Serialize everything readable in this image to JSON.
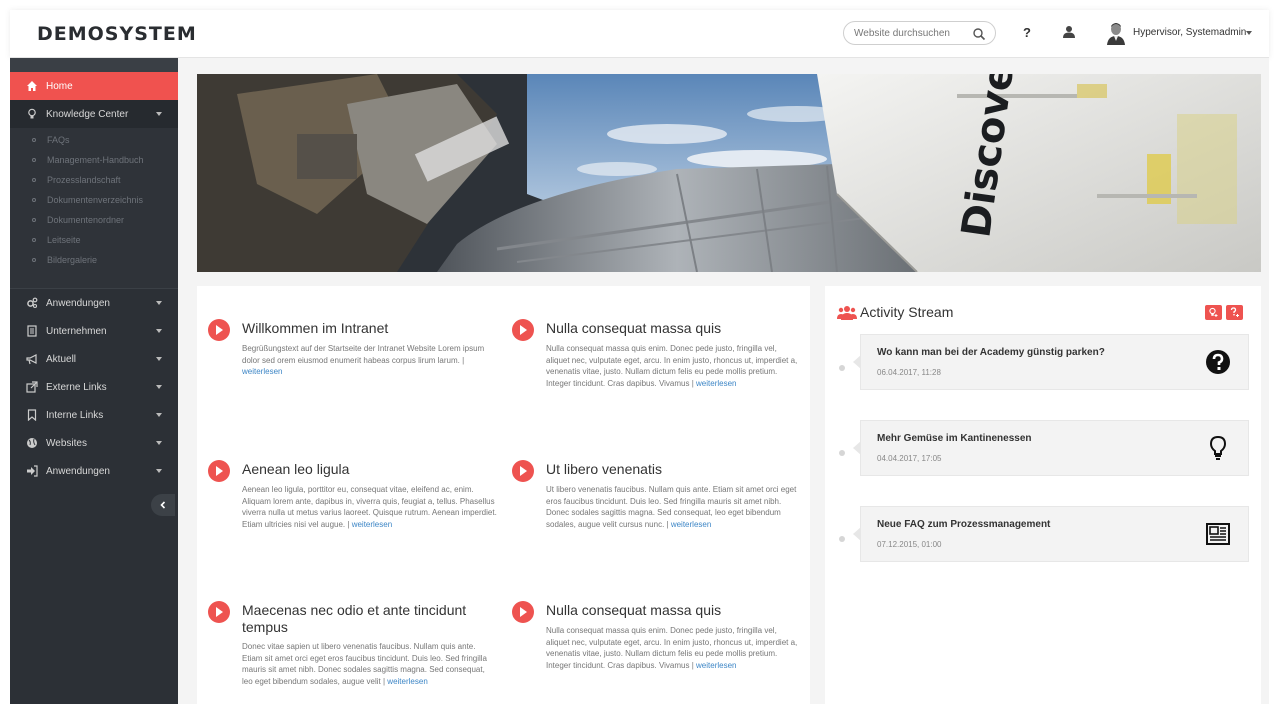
{
  "header": {
    "logo": "DEMOSYSTEM",
    "search_placeholder": "Website durchsuchen",
    "help_label": "?",
    "user_name": "Hypervisor, Systemadmin"
  },
  "sidebar": {
    "home_label": "Home",
    "knowledge_center": {
      "label": "Knowledge Center",
      "subitems": [
        "FAQs",
        "Management-Handbuch",
        "Prozesslandschaft",
        "Dokumentenverzeichnis",
        "Dokumentenordner",
        "Leitseite",
        "Bildergalerie"
      ]
    },
    "items": [
      "Anwendungen",
      "Unternehmen",
      "Aktuell",
      "Externe Links",
      "Interne Links",
      "Websites",
      "Anwendungen"
    ]
  },
  "articles": [
    {
      "title": "Willkommen im Intranet",
      "text": "Begrüßungstext auf der Startseite der Intranet Website Lorem ipsum dolor sed orem eiusmod enumerit habeas corpus lirum larum. | ",
      "link": "weiterlesen"
    },
    {
      "title": "Nulla consequat massa quis",
      "text": "Nulla consequat massa quis enim. Donec pede justo, fringilla vel, aliquet nec, vulputate eget, arcu. In enim justo, rhoncus ut, imperdiet a, venenatis vitae, justo. Nullam dictum felis eu pede mollis pretium. Integer tincidunt. Cras dapibus. Vivamus | ",
      "link": "weiterlesen"
    },
    {
      "title": "Aenean leo ligula",
      "text": "Aenean leo ligula, porttitor eu, consequat vitae, eleifend ac, enim. Aliquam lorem ante, dapibus in, viverra quis, feugiat a, tellus. Phasellus viverra nulla ut metus varius laoreet. Quisque rutrum. Aenean imperdiet. Etiam ultricies nisi vel augue. | ",
      "link": "weiterlesen"
    },
    {
      "title": "Ut libero venenatis",
      "text": "Ut libero venenatis faucibus. Nullam quis ante. Etiam sit amet orci eget eros faucibus tincidunt. Duis leo. Sed fringilla mauris sit amet nibh. Donec sodales sagittis magna. Sed consequat, leo eget bibendum sodales, augue velit cursus nunc. | ",
      "link": "weiterlesen"
    },
    {
      "title": "Maecenas nec odio et ante tincidunt tempus",
      "text": "Donec vitae sapien ut libero venenatis faucibus. Nullam quis ante. Etiam sit amet orci eget eros faucibus tincidunt. Duis leo. Sed fringilla mauris sit amet nibh. Donec sodales sagittis magna. Sed consequat, leo eget bibendum sodales, augue velit | ",
      "link": "weiterlesen"
    },
    {
      "title": "Nulla consequat massa quis",
      "text": "Nulla consequat massa quis enim. Donec pede justo, fringilla vel, aliquet nec, vulputate eget, arcu. In enim justo, rhoncus ut, imperdiet a, venenatis vitae, justo. Nullam dictum felis eu pede mollis pretium. Integer tincidunt. Cras dapibus. Vivamus | ",
      "link": "weiterlesen"
    }
  ],
  "activity": {
    "title": "Activity Stream",
    "buttons": [
      "idea-filter",
      "question-filter"
    ],
    "items": [
      {
        "title": "Wo kann man bei der Academy günstig parken?",
        "date": "06.04.2017, 11:28",
        "icon": "question-icon"
      },
      {
        "title": "Mehr Gemüse im Kantinenessen",
        "date": "04.04.2017, 17:05",
        "icon": "lightbulb-icon"
      },
      {
        "title": "Neue FAQ zum Prozessmanagement",
        "date": "07.12.2015, 01:00",
        "icon": "newspaper-icon"
      }
    ]
  },
  "hero_image": "space-shuttle-discovery-image",
  "hero_text": "Discover",
  "colors": {
    "accent": "#ee5350",
    "sidebar_bg": "#2c3036",
    "link": "#3d86c6"
  }
}
